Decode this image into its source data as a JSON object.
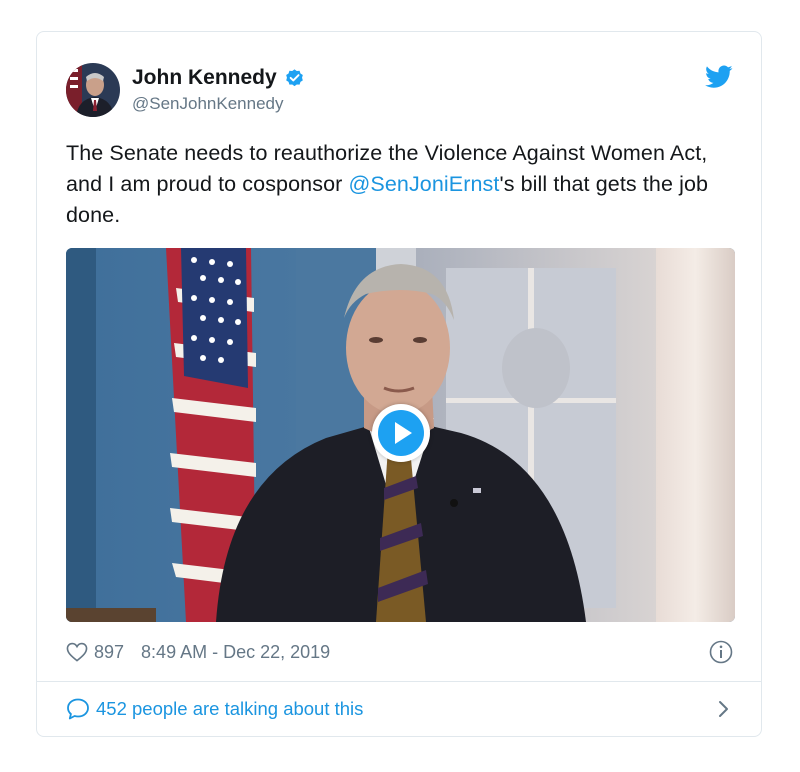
{
  "tweet": {
    "author": {
      "display_name": "John Kennedy",
      "handle": "@SenJohnKennedy",
      "verified": true
    },
    "text_before": "The Senate needs to reauthorize the Violence Against Women Act, and I am proud to cosponsor ",
    "mention": "@SenJoniErnst",
    "text_after": "'s bill that gets the job done.",
    "media": {
      "type": "video",
      "icon": "play-icon"
    },
    "likes": "897",
    "timestamp": "8:49 AM - Dec 22, 2019",
    "talking_text": "452 people are talking about this"
  },
  "colors": {
    "accent": "#1da1f2",
    "link": "#1b95e0",
    "muted": "#657786",
    "text": "#14171a",
    "border": "#e1e8ed"
  }
}
